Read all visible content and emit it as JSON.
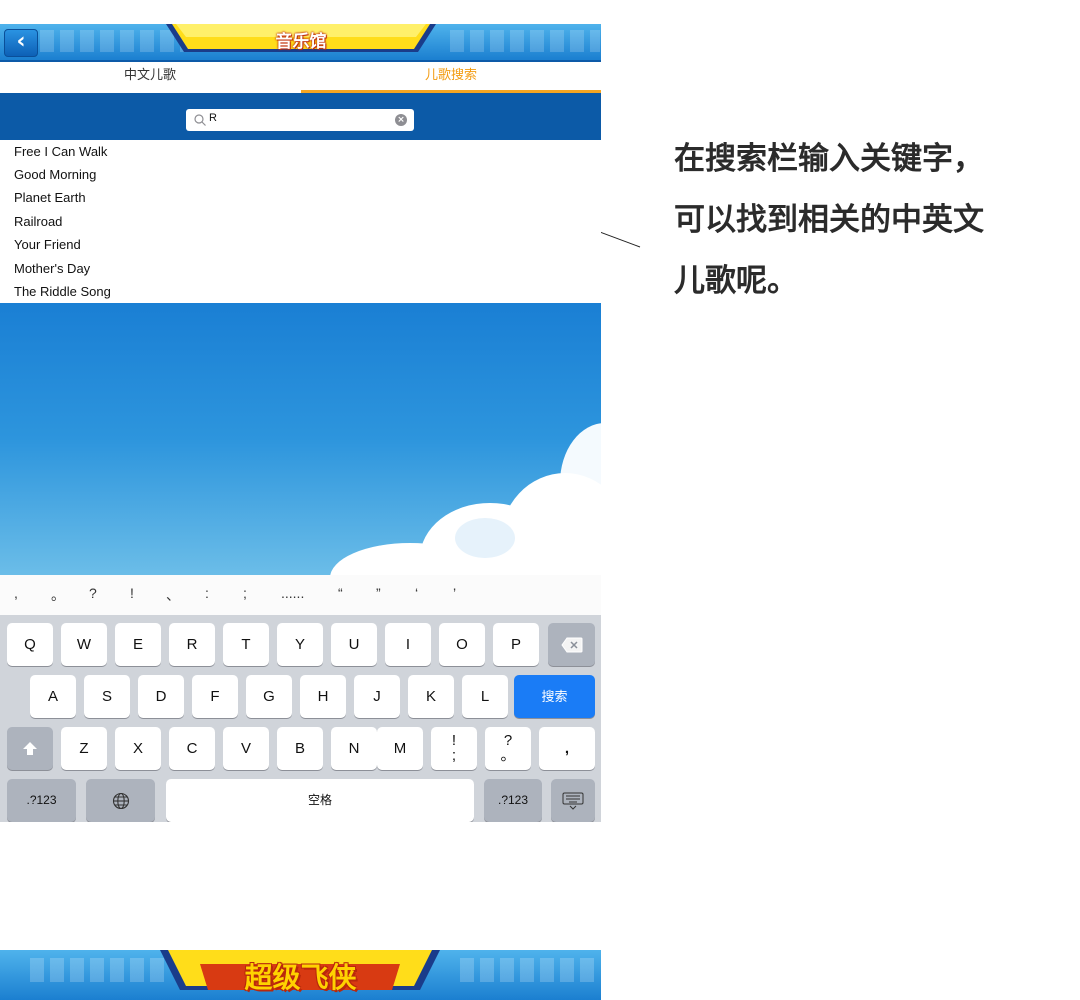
{
  "header": {
    "title": "音乐馆",
    "back_icon": "chevron-left-icon"
  },
  "tabs": [
    {
      "label": "中文儿歌",
      "active": false
    },
    {
      "label": "儿歌搜索",
      "active": true
    }
  ],
  "search": {
    "value": "R",
    "icon": "search-icon",
    "clear_icon": "clear-icon"
  },
  "results": [
    "Free I Can Walk",
    "Good Morning",
    "Planet Earth",
    "Railroad",
    "Your Friend",
    "Mother's Day",
    "The Riddle Song"
  ],
  "keyboard": {
    "punctuation": [
      ",",
      "。",
      "?",
      "!",
      "、",
      ":",
      ";",
      "......",
      "“",
      "”",
      "‘",
      "’"
    ],
    "row1": [
      "Q",
      "W",
      "E",
      "R",
      "T",
      "Y",
      "U",
      "I",
      "O",
      "P"
    ],
    "row2": [
      "A",
      "S",
      "D",
      "F",
      "G",
      "H",
      "J",
      "K",
      "L"
    ],
    "row3": [
      "Z",
      "X",
      "C",
      "V",
      "B",
      "N",
      "M"
    ],
    "search_key": "搜索",
    "space_key": "空格",
    "num_key_left": ".?123",
    "num_key_right": ".?123",
    "excl_key": "!\n;",
    "question_key": "?\n。",
    "comma_key": ",",
    "shift_icon": "shift-icon",
    "backspace_icon": "backspace-icon",
    "globe_icon": "globe-icon",
    "dismiss_icon": "keyboard-dismiss-icon"
  },
  "callout": {
    "lines": [
      "在搜索栏输入关键字，",
      "可以找到相关的中英文",
      "儿歌呢。"
    ]
  },
  "banner": {
    "logo_text": "超级飞侠"
  },
  "colors": {
    "accent_orange": "#f5a623",
    "search_band": "#0c5aa7",
    "search_key": "#1a7cf6"
  }
}
